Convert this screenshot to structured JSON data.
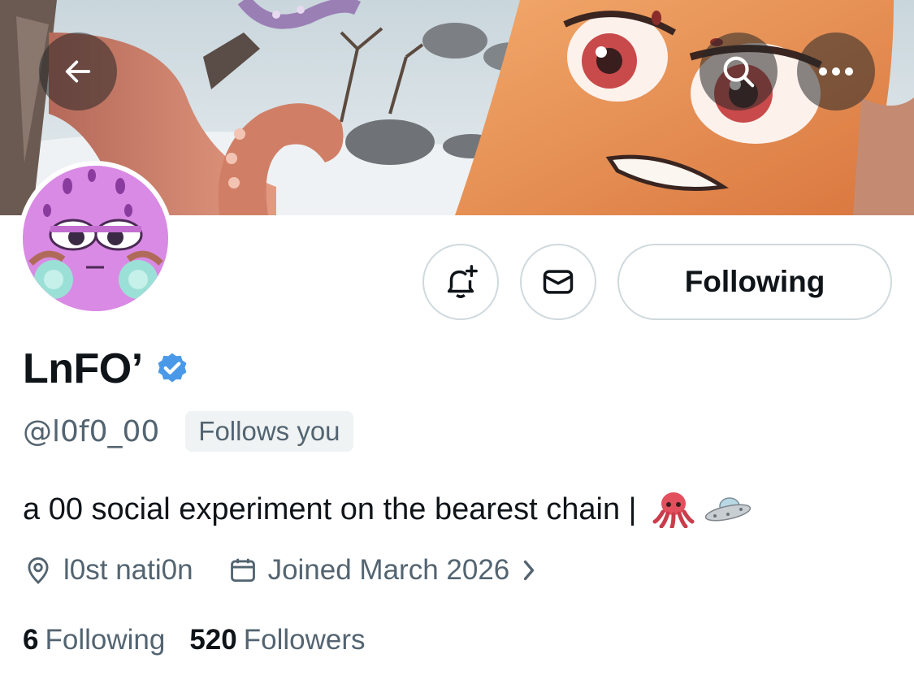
{
  "header": {
    "back_icon": "arrow-left-icon",
    "search_icon": "search-icon",
    "more_icon": "more-horizontal-icon"
  },
  "profile": {
    "display_name": "LnFO’",
    "verified": true,
    "verified_color": "#4a99e9",
    "handle": "@l0f0_00",
    "follows_you": "Follows you",
    "bio": "a 00 social experiment on the bearest chain |",
    "bio_emojis": [
      "octopus",
      "flying-saucer"
    ],
    "location": "l0st nati0n",
    "joined": "Joined March 2026",
    "following_count": "6",
    "following_label": "Following",
    "followers_count": "520",
    "followers_label": "Followers"
  },
  "actions": {
    "notify_icon": "bell-plus-icon",
    "message_icon": "envelope-icon",
    "following_button": "Following"
  },
  "colors": {
    "text_primary": "#0f1419",
    "text_secondary": "#536471",
    "border": "#cfd9de",
    "badge_bg": "#eff3f4"
  }
}
